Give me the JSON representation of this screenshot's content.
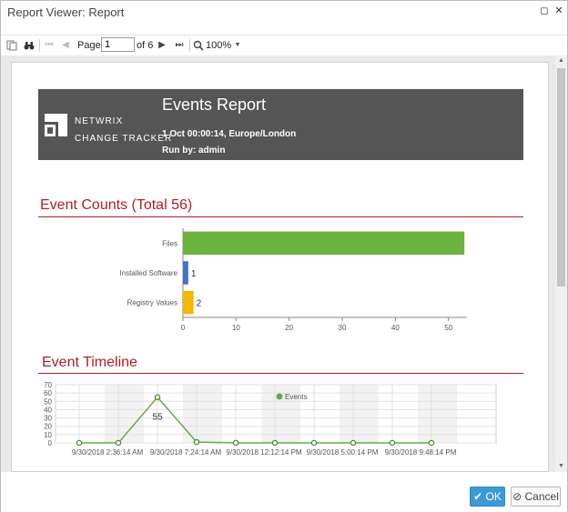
{
  "window": {
    "title": "Report Viewer: Report",
    "maximize_glyph": "◻",
    "close_glyph": "✕"
  },
  "toolbar": {
    "page_label": "Page",
    "page_value": "1",
    "of_label": "of 6",
    "zoom_value": "100%",
    "icons": [
      "page-layout-icon",
      "binoculars-icon",
      "first-page-icon",
      "prev-page-icon",
      "next-page-icon",
      "last-page-icon",
      "zoom-icon",
      "chevron-down-icon"
    ]
  },
  "report": {
    "title": "Events Report",
    "brand_line1": "NETWRIX",
    "brand_line2": "CHANGE TRACKER",
    "date_line": "1 Oct 00:00:14, Europe/London",
    "run_by": "Run by: admin",
    "header_color": "#555555"
  },
  "section_counts": {
    "title": "Event Counts (Total 56)"
  },
  "section_timeline": {
    "title": "Event Timeline"
  },
  "chart_data": [
    {
      "type": "bar",
      "orientation": "horizontal",
      "title": "",
      "categories": [
        "Files",
        "Installed Software",
        "Registry Values"
      ],
      "values": [
        53,
        1,
        2
      ],
      "colors": [
        "#6db33f",
        "#4472c4",
        "#f5b800"
      ],
      "xlim": [
        0,
        60
      ],
      "xticks": [
        0,
        10,
        20,
        30,
        40,
        50,
        60
      ],
      "data_labels": [
        "53",
        "1",
        "2"
      ],
      "grid": false
    },
    {
      "type": "line",
      "title": "",
      "x": [
        "9/30/2018 2:36:14 AM",
        "",
        "",
        "",
        "",
        "",
        "",
        "",
        "",
        ""
      ],
      "values": [
        0,
        0,
        55,
        1,
        0,
        0,
        0,
        0,
        0,
        0
      ],
      "series": [
        {
          "name": "Events",
          "values": [
            0,
            0,
            55,
            1,
            0,
            0,
            0,
            0,
            0,
            0
          ]
        }
      ],
      "xtick_labels": [
        "9/30/2018 2:36:14 AM",
        "9/30/2018 7:24:14 AM",
        "9/30/2018 12:12:14 PM",
        "9/30/2018 5:00:14 PM",
        "9/30/2018 9:48:14 PM"
      ],
      "ylim": [
        0,
        70
      ],
      "yticks": [
        0,
        10,
        20,
        30,
        40,
        50,
        60,
        70
      ],
      "data_labels": [
        {
          "index": 2,
          "text": "55"
        }
      ],
      "legend": "top-center",
      "grid": true,
      "color": "#6aa84f"
    }
  ],
  "footer": {
    "ok_label": "OK",
    "cancel_label": "Cancel",
    "ok_color": "#3d9ad8"
  }
}
